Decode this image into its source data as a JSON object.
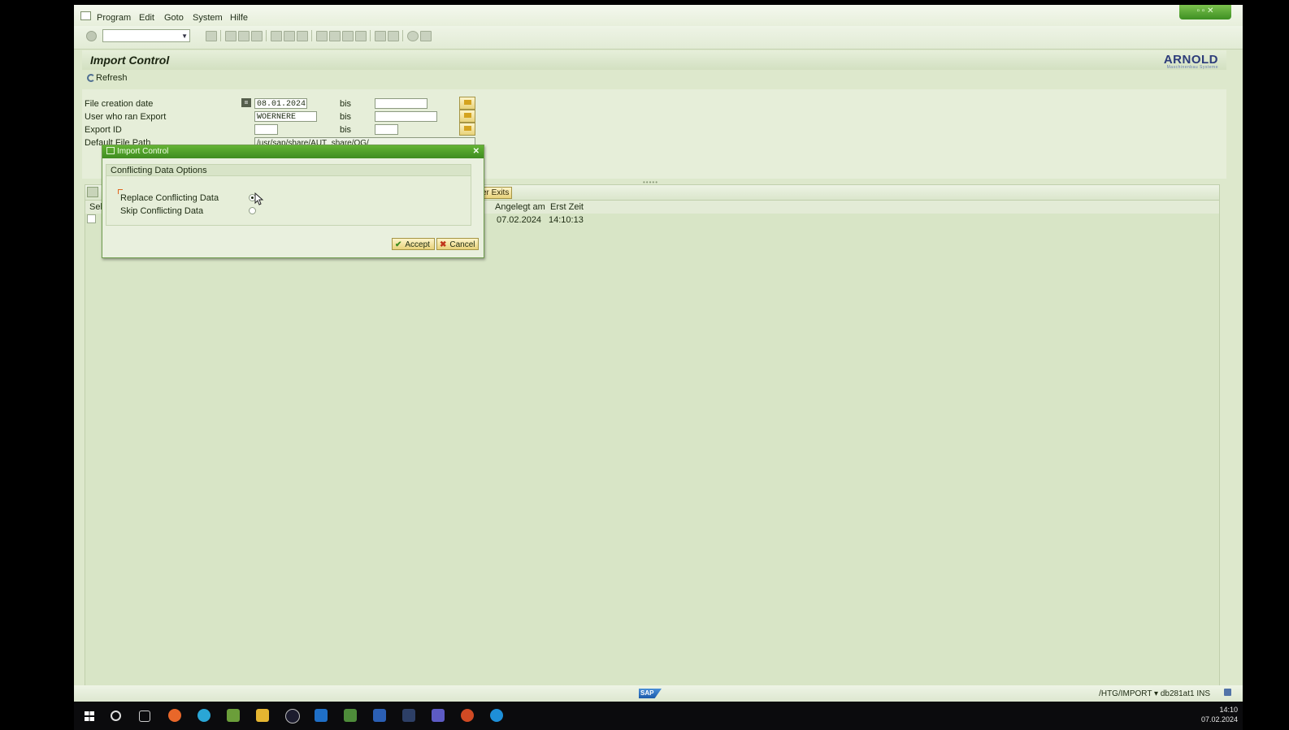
{
  "menubar": {
    "items": [
      "Program",
      "Edit",
      "Goto",
      "System",
      "Hilfe"
    ]
  },
  "header": {
    "title": "Import Control",
    "logo_text": "ARNOLD",
    "logo_sub": "Maschinenbau Systeme"
  },
  "app_toolbar": {
    "refresh_label": "Refresh"
  },
  "selection": {
    "file_creation_date_label": "File creation date",
    "file_creation_date_value": "08.01.2024",
    "user_label": "User who ran Export",
    "user_value": "WOERNERE",
    "export_id_label": "Export ID",
    "export_id_value": "",
    "default_path_label": "Default File Path",
    "default_path_value": "/usr/sap/share/AUT_share/QG/",
    "bis_label": "bis"
  },
  "grid": {
    "user_exits_label": "er Exits",
    "columns": [
      "Sel",
      "Angelegt am",
      "Erst Zeit"
    ],
    "rows": [
      {
        "angelegt_am": "07.02.2024",
        "erst_zeit": "14:10:13"
      }
    ]
  },
  "dialog": {
    "title": "Import Control",
    "frame_title": "Conflicting Data Options",
    "option_replace": "Replace Conflicting Data",
    "option_skip": "Skip Conflicting Data",
    "selected_option": "replace",
    "accept_label": "Accept",
    "cancel_label": "Cancel"
  },
  "statusbar": {
    "sap_logo": "SAP",
    "info": "/HTG/IMPORT ▾  db281at1  INS"
  },
  "taskbar": {
    "time": "14:10",
    "date": "07.02.2024"
  },
  "colors": {
    "accent_green": "#3e8c20",
    "background": "#dde8cc",
    "button_yellow": "#e8d27a"
  }
}
